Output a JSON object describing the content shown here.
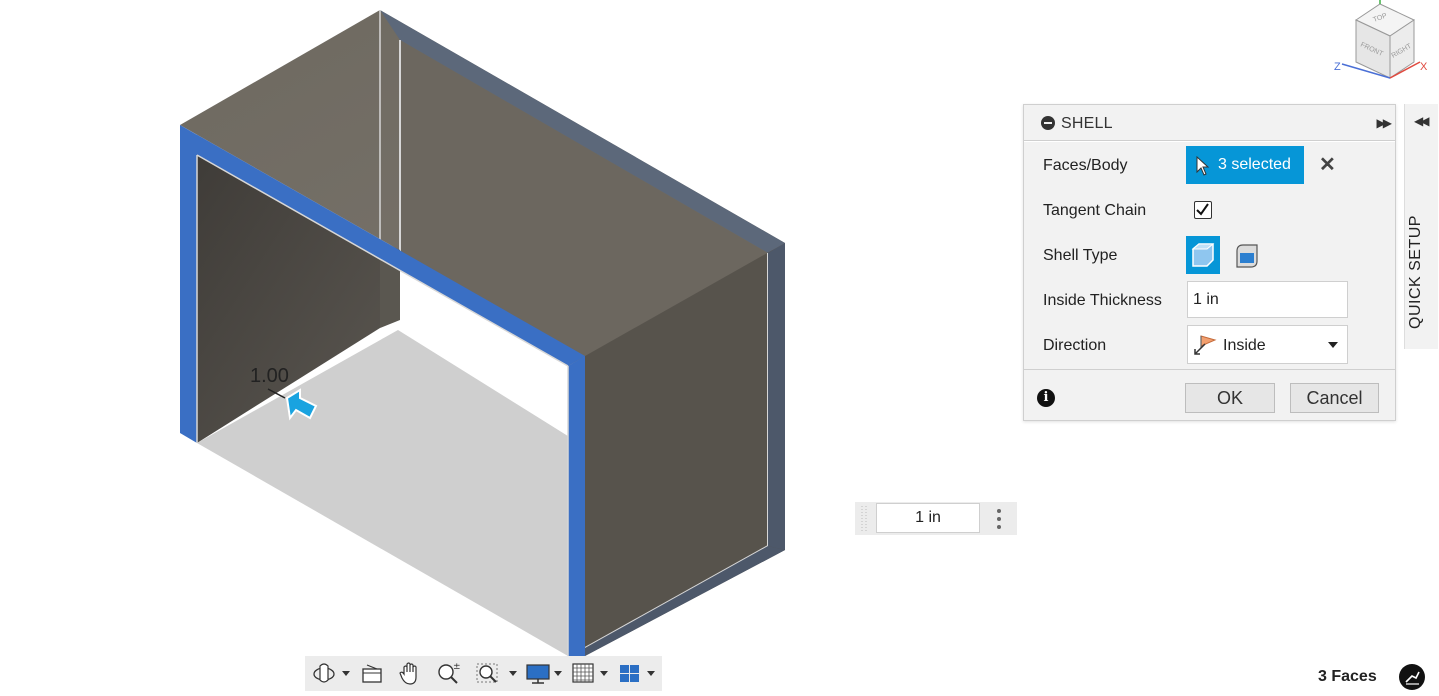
{
  "viewcube": {
    "top": "TOP",
    "front": "FRONT",
    "right": "RIGHT",
    "axis_x": "X",
    "axis_z": "Z"
  },
  "viewport": {
    "dimension_label": "1.00"
  },
  "shell_dialog": {
    "title": "SHELL",
    "faces_body": {
      "label": "Faces/Body",
      "value": "3 selected"
    },
    "tangent_chain": {
      "label": "Tangent Chain",
      "checked": true
    },
    "shell_type": {
      "label": "Shell Type"
    },
    "inside_thickness": {
      "label": "Inside Thickness",
      "value": "1 in"
    },
    "direction": {
      "label": "Direction",
      "value": "Inside"
    },
    "ok_label": "OK",
    "cancel_label": "Cancel"
  },
  "quick_setup": {
    "label": "QUICK SETUP"
  },
  "thickness_float": {
    "value": "1 in"
  },
  "status": {
    "selection": "3 Faces"
  },
  "colors": {
    "accent": "#0696d7",
    "selected_face": "#3a6fc4",
    "body_face": "#6f6a62",
    "body_edge": "#5a6475"
  },
  "toolbar": {
    "items": [
      "orbit-icon",
      "look-at-icon",
      "pan-icon",
      "zoom-icon",
      "fit-icon",
      "display-settings-icon",
      "grid-icon",
      "viewports-icon"
    ]
  }
}
